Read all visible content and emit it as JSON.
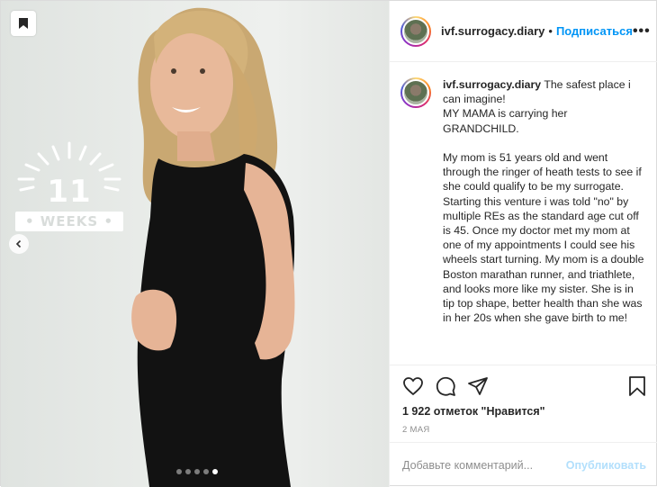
{
  "post": {
    "username": "ivf.surrogacy.diary",
    "separator": "•",
    "follow_label": "Подписаться",
    "more_label": "•••",
    "caption_lines": "The safest place i can imagine!\nMY MAMA is carrying her GRANDCHILD.\n\nMy mom is 51 years old and went through the ringer of heath tests to see if she could qualify to be my surrogate. Starting this venture i was told \"no\" by multiple REs as the standard age cut off is 45. Once my doctor met my mom at one of my appointments I could see his wheels start turning. My mom is a double Boston marathan runner, and triathlete, and looks more like my sister. She is in tip top shape, better health than she was in her 20s when she gave birth to me!",
    "likes_text": "1 922 отметок \"Нравится\"",
    "date_text": "2 МАЯ",
    "comment_placeholder": "Добавьте комментарий...",
    "publish_label": "Опубликовать"
  },
  "media": {
    "badge_number": "11",
    "badge_label": "• WEEKS •",
    "carousel_dots": 5,
    "active_dot": 5
  },
  "colors": {
    "accent": "#0095f6",
    "publish_disabled": "#b2dffc",
    "muted": "#8e8e8e",
    "text": "#262626",
    "dress": "#111111"
  }
}
